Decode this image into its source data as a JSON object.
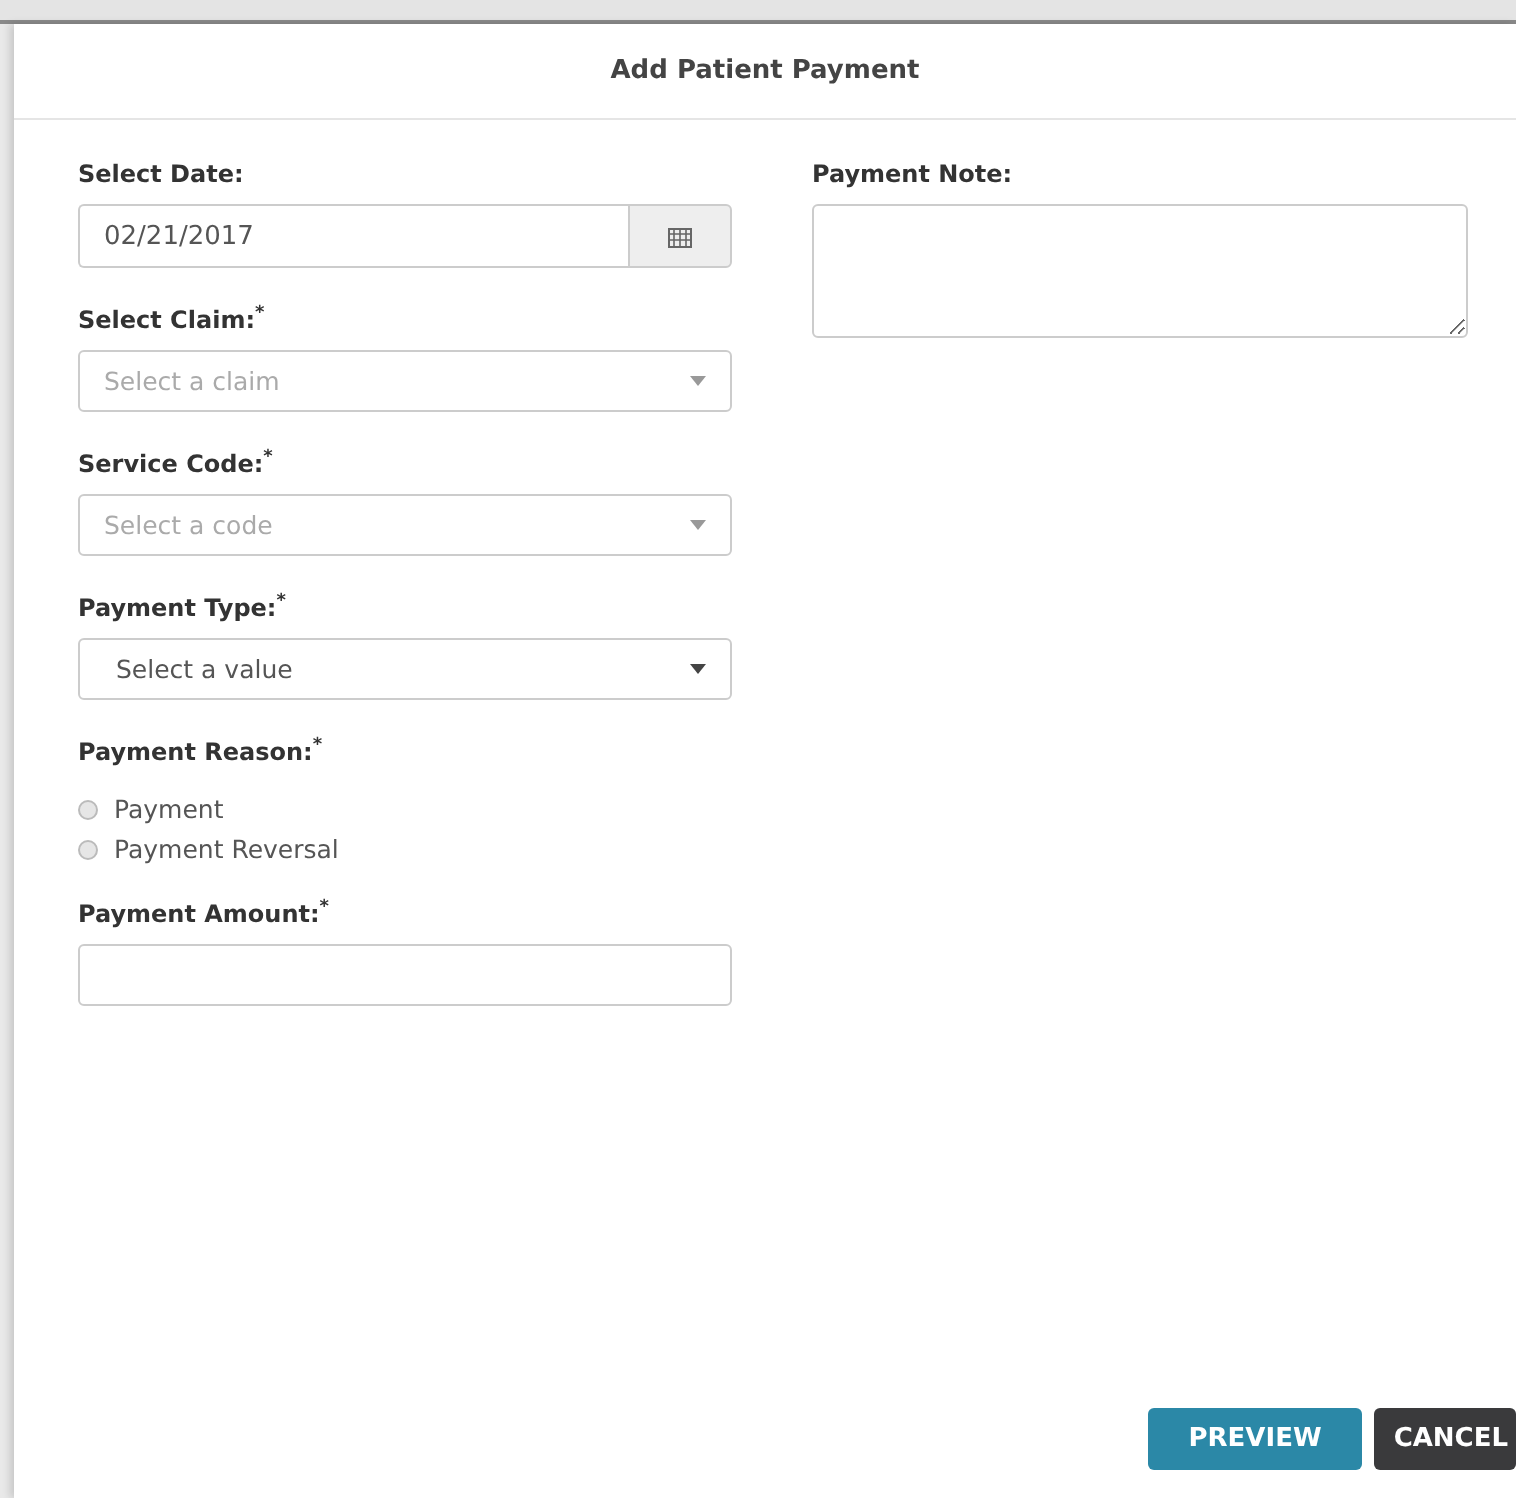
{
  "dialog": {
    "title": "Add Patient Payment"
  },
  "fields": [
    {
      "kind": "date",
      "label": "Select Date:",
      "value": "02/21/2017"
    },
    {
      "kind": "select",
      "label": "Select Claim:$^{*}$",
      "placeholder": "Select a claim",
      "disabled": true
    },
    {
      "kind": "select",
      "label": "Service Code:$^{*}$",
      "placeholder": "Select a code",
      "disabled": true
    },
    {
      "kind": "select",
      "label": "Payment Type:$^{*}$",
      "placeholder": "Select a value",
      "disabled": false
    },
    {
      "kind": "radio",
      "label": "Payment Reason:$^{*}$",
      "options": [
        {
          "label": "Payment",
          "selected": false
        },
        {
          "label": "Payment Reversal",
          "selected": false
        }
      ]
    },
    {
      "kind": "text",
      "label": "Payment Amount:$^{*}$"
    }
  ],
  "note": {
    "label": "Payment Note:"
  },
  "buttons": [
    {
      "kind": "primary",
      "label": "PREVIEW"
    },
    {
      "kind": "dark",
      "label": "CANCEL"
    }
  ]
}
